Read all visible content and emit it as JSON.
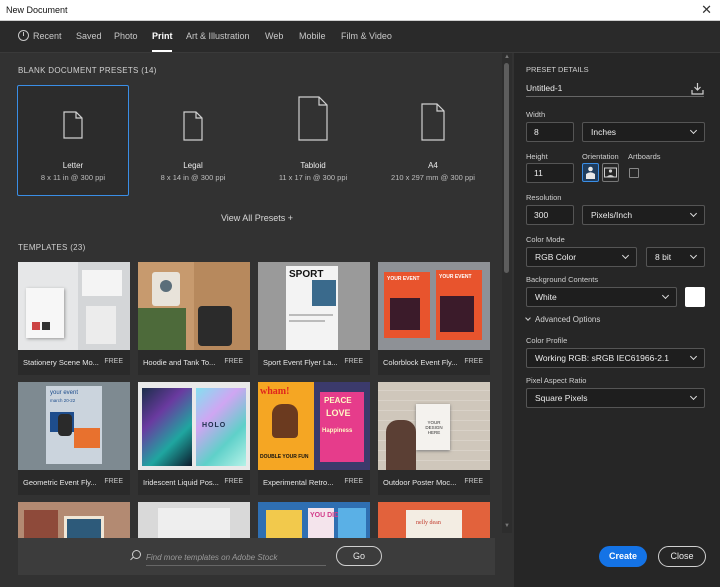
{
  "window": {
    "title": "New Document",
    "close_glyph": "✕"
  },
  "tabs": [
    {
      "label": "Recent"
    },
    {
      "label": "Saved"
    },
    {
      "label": "Photo"
    },
    {
      "label": "Print",
      "active": true
    },
    {
      "label": "Art & Illustration"
    },
    {
      "label": "Web"
    },
    {
      "label": "Mobile"
    },
    {
      "label": "Film & Video"
    }
  ],
  "presets": {
    "heading": "BLANK DOCUMENT PRESETS",
    "count": "(14)",
    "items": [
      {
        "name": "Letter",
        "size": "8 x 11 in @ 300 ppi",
        "selected": true
      },
      {
        "name": "Legal",
        "size": "8 x 14 in @ 300 ppi"
      },
      {
        "name": "Tabloid",
        "size": "11 x 17 in @ 300 ppi"
      },
      {
        "name": "A4",
        "size": "210 x 297 mm @ 300 ppi"
      }
    ],
    "view_all": "View All Presets +"
  },
  "templates": {
    "heading": "TEMPLATES",
    "count": "(23)",
    "items": [
      {
        "name": "Stationery Scene Mo...",
        "badge": "FREE"
      },
      {
        "name": "Hoodie and Tank To...",
        "badge": "FREE"
      },
      {
        "name": "Sport Event Flyer La...",
        "badge": "FREE"
      },
      {
        "name": "Colorblock Event Fly...",
        "badge": "FREE"
      },
      {
        "name": "Geometric Event Fly...",
        "badge": "FREE"
      },
      {
        "name": "Iridescent Liquid Pos...",
        "badge": "FREE"
      },
      {
        "name": "Experimental Retro...",
        "badge": "FREE"
      },
      {
        "name": "Outdoor Poster Moc...",
        "badge": "FREE"
      }
    ],
    "thumb_text": {
      "sport": "SPORT",
      "your_event": "YOUR EVENT",
      "geo_event": "your event",
      "geo_date": "march 20-22",
      "holo": "HOLO",
      "whami": "wham!",
      "peace": "PEACE",
      "love": "LOVE",
      "happiness": "Happiness",
      "doubleyourfun": "DOUBLE YOUR FUN",
      "your_design": "YOUR DESIGN HERE",
      "you_did": "YOU DID",
      "nelly": "nelly dean"
    }
  },
  "search": {
    "placeholder": "Find more templates on Adobe Stock",
    "go_label": "Go"
  },
  "details": {
    "heading": "PRESET DETAILS",
    "name": "Untitled-1",
    "width_label": "Width",
    "width_value": "8",
    "width_unit": "Inches",
    "height_label": "Height",
    "height_value": "11",
    "orientation_label": "Orientation",
    "artboards_label": "Artboards",
    "resolution_label": "Resolution",
    "resolution_value": "300",
    "resolution_unit": "Pixels/Inch",
    "color_mode_label": "Color Mode",
    "color_mode": "RGB Color",
    "bit_depth": "8 bit",
    "bg_label": "Background Contents",
    "bg_value": "White",
    "bg_color": "#ffffff",
    "advanced_label": "Advanced Options",
    "profile_label": "Color Profile",
    "profile_value": "Working RGB: sRGB IEC61966-2.1",
    "pixel_ratio_label": "Pixel Aspect Ratio",
    "pixel_ratio_value": "Square Pixels"
  },
  "actions": {
    "create_label": "Create",
    "close_label": "Close"
  },
  "colors": {
    "accent": "#1473e6",
    "selection": "#3a8ee6"
  }
}
